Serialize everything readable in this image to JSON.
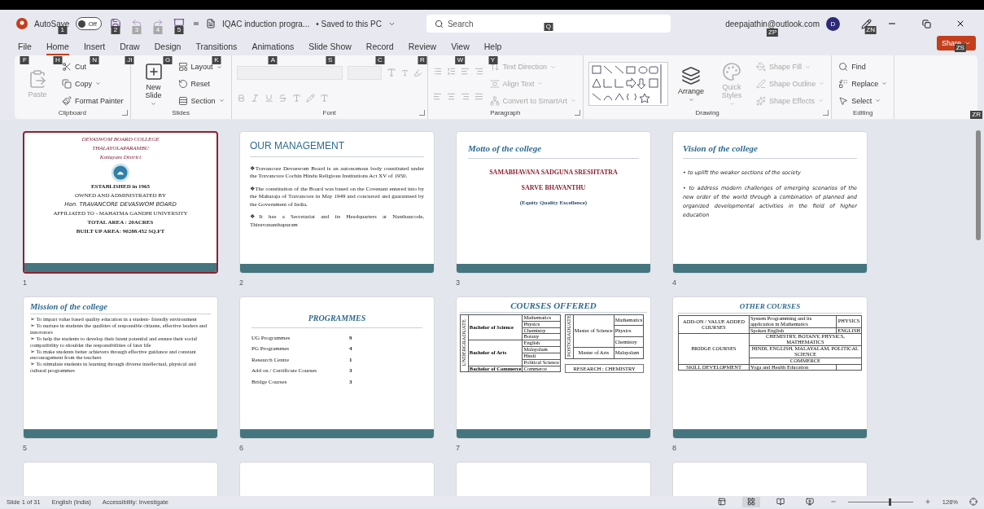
{
  "titlebar": {
    "autosave_label": "AutoSave",
    "autosave_keytip": "1",
    "autosave": {
      "on": false,
      "label": "Off"
    },
    "quick_access": [
      {
        "kind": "save",
        "keytip": "2",
        "disabled": false
      },
      {
        "kind": "undo",
        "keytip": "3",
        "disabled": true
      },
      {
        "kind": "redo",
        "keytip": "4",
        "disabled": true
      },
      {
        "kind": "present",
        "keytip": "5",
        "disabled": false
      }
    ],
    "file_name": "IQAC induction progra...",
    "save_status": "• Saved to this PC",
    "search": {
      "placeholder": "Search",
      "keytip": "Q"
    },
    "account": "deepajathin@outlook.com",
    "account_keytip": "ZP",
    "avatar": "D",
    "coauthor_keytip": "ZN",
    "share": {
      "label": "Share",
      "keytip": "ZS"
    },
    "ribbon_keytip": "ZR"
  },
  "tabs": [
    {
      "label": "File",
      "keytip": "F",
      "selected": false
    },
    {
      "label": "Home",
      "keytip": "H",
      "selected": true
    },
    {
      "label": "Insert",
      "keytip": "N",
      "selected": false
    },
    {
      "label": "Draw",
      "keytip": "JI",
      "selected": false
    },
    {
      "label": "Design",
      "keytip": "G",
      "selected": false
    },
    {
      "label": "Transitions",
      "keytip": "K",
      "selected": false
    },
    {
      "label": "Animations",
      "keytip": "A",
      "selected": false
    },
    {
      "label": "Slide Show",
      "keytip": "S",
      "selected": false
    },
    {
      "label": "Record",
      "keytip": "C",
      "selected": false
    },
    {
      "label": "Review",
      "keytip": "R",
      "selected": false
    },
    {
      "label": "View",
      "keytip": "W",
      "selected": false
    },
    {
      "label": "Help",
      "keytip": "Y",
      "selected": false
    }
  ],
  "ribbon": [
    {
      "label": "Clipboard",
      "launcher": true,
      "columns": [
        [
          {
            "kind": "large",
            "label": "Paste",
            "disabled": true
          }
        ],
        [
          {
            "kind": "small",
            "label": "Cut",
            "disabled": false
          },
          {
            "kind": "small",
            "label": "Copy",
            "disabled": false,
            "dropdown": true
          },
          {
            "kind": "small",
            "label": "Format Painter",
            "disabled": false
          }
        ]
      ]
    },
    {
      "label": "Slides",
      "launcher": false,
      "columns": [
        [
          {
            "kind": "large",
            "label": "New Slide",
            "disabled": false,
            "dropdown": true
          }
        ],
        [
          {
            "kind": "small",
            "label": "Layout",
            "disabled": false,
            "dropdown": true
          },
          {
            "kind": "small",
            "label": "Reset",
            "disabled": false
          },
          {
            "kind": "small",
            "label": "Section",
            "disabled": false,
            "dropdown": true
          }
        ]
      ]
    },
    {
      "label": "Font",
      "launcher": true,
      "columns": [
        [
          {
            "kind": "fontrow",
            "disabled": true
          },
          {
            "kind": "formatrow",
            "disabled": true
          }
        ]
      ]
    },
    {
      "label": "Paragraph",
      "launcher": true,
      "columns": [
        [
          {
            "kind": "listrow",
            "disabled": true
          },
          {
            "kind": "alignrow",
            "disabled": true
          }
        ],
        [
          {
            "kind": "small",
            "label": "Text Direction",
            "disabled": true,
            "dropdown": true
          },
          {
            "kind": "small",
            "label": "Align Text",
            "disabled": true,
            "dropdown": true
          },
          {
            "kind": "small",
            "label": "Convert to SmartArt",
            "disabled": true,
            "dropdown": true
          }
        ]
      ]
    },
    {
      "label": "Drawing",
      "launcher": true,
      "columns": [
        [
          {
            "kind": "gallery",
            "disabled": false
          }
        ],
        [
          {
            "kind": "large",
            "label": "Arrange",
            "disabled": false,
            "dropdown": true
          }
        ],
        [
          {
            "kind": "large",
            "label": "Quick Styles",
            "disabled": true,
            "dropdown": true
          }
        ],
        [
          {
            "kind": "small",
            "label": "Shape Fill",
            "disabled": true,
            "dropdown": true
          },
          {
            "kind": "small",
            "label": "Shape Outline",
            "disabled": true,
            "dropdown": true
          },
          {
            "kind": "small",
            "label": "Shape Effects",
            "disabled": true,
            "dropdown": true
          }
        ]
      ]
    },
    {
      "label": "Editing",
      "launcher": false,
      "columns": [
        [
          {
            "kind": "small",
            "label": "Find",
            "disabled": false
          },
          {
            "kind": "small",
            "label": "Replace",
            "disabled": false,
            "dropdown": true
          },
          {
            "kind": "small",
            "label": "Select",
            "disabled": false,
            "dropdown": true
          }
        ]
      ]
    }
  ],
  "slides": [
    {
      "number": "1",
      "selected": true,
      "kind": "cover",
      "header": [
        "DEVASWOM BOARD COLLEGE",
        "THALAYOLAPARAMBU",
        "Kottayam District"
      ],
      "lines": [
        "ESTABLISHED in 1965",
        "OWNED AND ADMINISTRATED BY",
        "Hon. TRAVANCORE DEVASWOM BOARD",
        "AFFILIATED TO - MAHATMA GANDHI UNIVERSITY",
        "TOTAL AREA : 20ACRES",
        "BUILT UP AREA: 90288.452 SQ.FT"
      ]
    },
    {
      "number": "2",
      "selected": false,
      "kind": "paragraphs",
      "title": "OUR MANAGEMENT",
      "paragraphs": [
        "❖Travancore Devaswom Board is an autonomous body constituted under the Travancore Cochin Hindu Religious Institutions Act XV of 1950.",
        "❖The constitution of the Board was based on the Covenant entered into by the Maharaja of Travancore in May 1949 and concurred and guaranteed by the Government of India.",
        "❖It has a Secretariat and its Headquarters at Nanthancode, Thiruvananthapuram"
      ]
    },
    {
      "number": "3",
      "selected": false,
      "kind": "motto",
      "title": "Motto of the college",
      "lines": [
        "SAMABHAVANA SADGUNA SRESHTATRA",
        "SARVE BHAVANTHU"
      ],
      "note": "(Equity Quality Excellence)"
    },
    {
      "number": "4",
      "selected": false,
      "kind": "bullets",
      "title": "Vision of the college",
      "bullets": [
        "• to uplift the weaker sections of the society",
        "• to address modern challenges of emerging scenarios of the new order of the world through a combination of planned and organized developmental activities in the field of higher education"
      ]
    },
    {
      "number": "5",
      "selected": false,
      "kind": "arrows",
      "title": "Mission of the college",
      "bullets": [
        "➢ To impart value based quality education in a student- friendly environment",
        "➢ To nurture in students the qualities of responsible citizens, effective leaders and innovators",
        "➢ To help the students to develop their latent potential and ensure their social compatibility to shoulder the responsibilities of later life",
        "➢ To make students better achievers through effective guidance and constant encouragement from the teachers",
        "➢ To stimulate students in learning through diverse intellectual, physical and cultural programmes"
      ]
    },
    {
      "number": "6",
      "selected": false,
      "kind": "list",
      "title": "PROGRAMMES",
      "rows": [
        [
          "UG Programmes",
          "9"
        ],
        [
          "PG Programmes",
          "4"
        ],
        [
          "Research Centre",
          "1"
        ],
        [
          "Add on / Certificate Courses",
          "3"
        ],
        [
          "Bridge Courses",
          "3"
        ]
      ]
    },
    {
      "number": "7",
      "selected": false,
      "kind": "courses",
      "title": "COURSES OFFERED",
      "groups": [
        {
          "level": "UNDERGRADUATE",
          "degrees": [
            {
              "name": "Bachelor of Science",
              "subjects": [
                "Mathematics",
                "Physics",
                "Chemistry",
                "Botany"
              ]
            },
            {
              "name": "Bachelor of Arts",
              "subjects": [
                "English",
                "Malayalam",
                "Hindi",
                "Political Science"
              ]
            },
            {
              "name": "Bachelor of Commerce",
              "subjects": [
                "Commerce"
              ]
            }
          ]
        },
        {
          "level": "POSTGRADUATE",
          "degrees": [
            {
              "name": "Master of Science",
              "subjects": [
                "Mathematics",
                "Physics",
                "Chemistry"
              ]
            },
            {
              "name": "Master of Arts",
              "subjects": [
                "Malayalam"
              ]
            }
          ]
        }
      ],
      "note": "RESEARCH : CHEMISTRY"
    },
    {
      "number": "8",
      "selected": false,
      "kind": "other",
      "title": "OTHER COURSES",
      "groups": [
        {
          "label": "ADD-ON / VALUE ADDED COURSES",
          "rows": [
            [
              "System Programming and its application in Mathematics",
              "PHYSICS"
            ],
            [
              "Spoken English",
              "ENGLISH"
            ]
          ]
        },
        {
          "label": "BRIDGE COURSES",
          "rows": [
            [
              "CHEMISTRY, BOTANY, PHYSICS, MATHEMATICS"
            ],
            [
              "HINDI, ENGLISH, MALAYALAM, POLITICAL SCIENCE"
            ],
            [
              "COMMERCE"
            ]
          ]
        },
        {
          "label": "SKILL DEVELOPMENT",
          "rows": [
            [
              "Yoga and Health Education",
              ""
            ]
          ]
        }
      ]
    },
    {
      "selected": false,
      "kind": "blank"
    },
    {
      "selected": false,
      "kind": "blank"
    },
    {
      "selected": false,
      "kind": "blank"
    },
    {
      "selected": false,
      "kind": "blank"
    }
  ],
  "status_bar": {
    "slide": "Slide 1 of 31",
    "language": "English (India)",
    "accessibility": "Accessibility: Investigate",
    "views": [
      {
        "kind": "normal",
        "selected": false
      },
      {
        "kind": "sorter",
        "selected": true
      },
      {
        "kind": "reading",
        "selected": false
      },
      {
        "kind": "show",
        "selected": false
      }
    ],
    "zoom": {
      "level": 0.64,
      "label": "126%"
    }
  }
}
